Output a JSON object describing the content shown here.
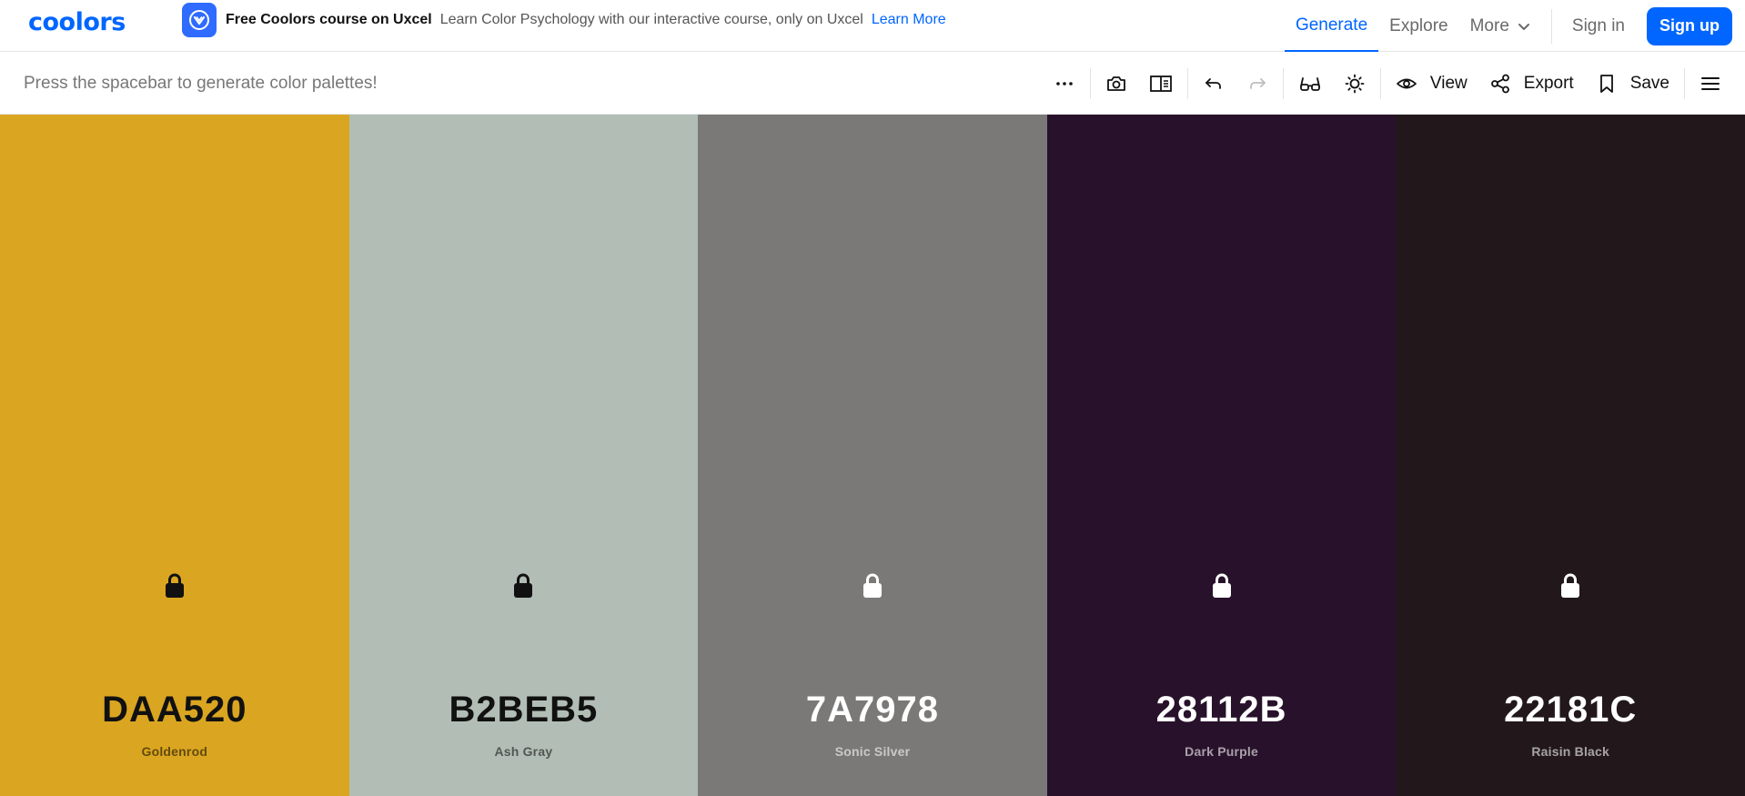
{
  "brand": {
    "logo_text": "coolors",
    "color": "#0066ff"
  },
  "promo": {
    "badge_icon": "uxcel-icon",
    "title": "Free Coolors course on Uxcel",
    "text": "Learn Color Psychology with our interactive course, only on Uxcel",
    "link": "Learn More"
  },
  "nav": {
    "generate": "Generate",
    "explore": "Explore",
    "more": "More",
    "sign_in": "Sign in",
    "sign_up": "Sign up"
  },
  "toolbar": {
    "hint": "Press the spacebar to generate color palettes!",
    "view": "View",
    "export": "Export",
    "save": "Save"
  },
  "palette": [
    {
      "hex": "DAA520",
      "name": "Goldenrod",
      "color": "#DAA520",
      "text_tone": "dark"
    },
    {
      "hex": "B2BEB5",
      "name": "Ash Gray",
      "color": "#B2BEB5",
      "text_tone": "dark"
    },
    {
      "hex": "7A7978",
      "name": "Sonic Silver",
      "color": "#7A7978",
      "text_tone": "light"
    },
    {
      "hex": "28112B",
      "name": "Dark Purple",
      "color": "#28112B",
      "text_tone": "light"
    },
    {
      "hex": "22181C",
      "name": "Raisin Black",
      "color": "#22181C",
      "text_tone": "light"
    }
  ]
}
